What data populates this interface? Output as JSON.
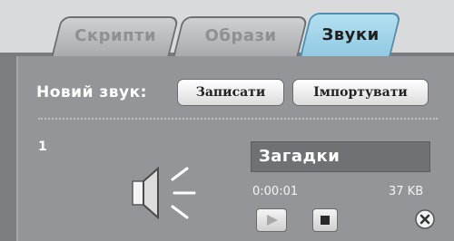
{
  "tabs": [
    {
      "label": "Скрипти",
      "active": false
    },
    {
      "label": "Образи",
      "active": false
    },
    {
      "label": "Звуки",
      "active": true
    }
  ],
  "toolbar": {
    "new_sound_label": "Новий звук:",
    "record_label": "Записати",
    "import_label": "Імпортувати"
  },
  "sound": {
    "index": "1",
    "name": "Загадки",
    "duration": "0:00:01",
    "size": "37 KB"
  },
  "icons": {
    "speaker": "speaker-icon",
    "play": "play-icon",
    "stop": "stop-icon",
    "delete": "delete-icon"
  },
  "colors": {
    "active_tab": "#a3d6ec",
    "panel": "#949598",
    "name_field": "#707175"
  }
}
